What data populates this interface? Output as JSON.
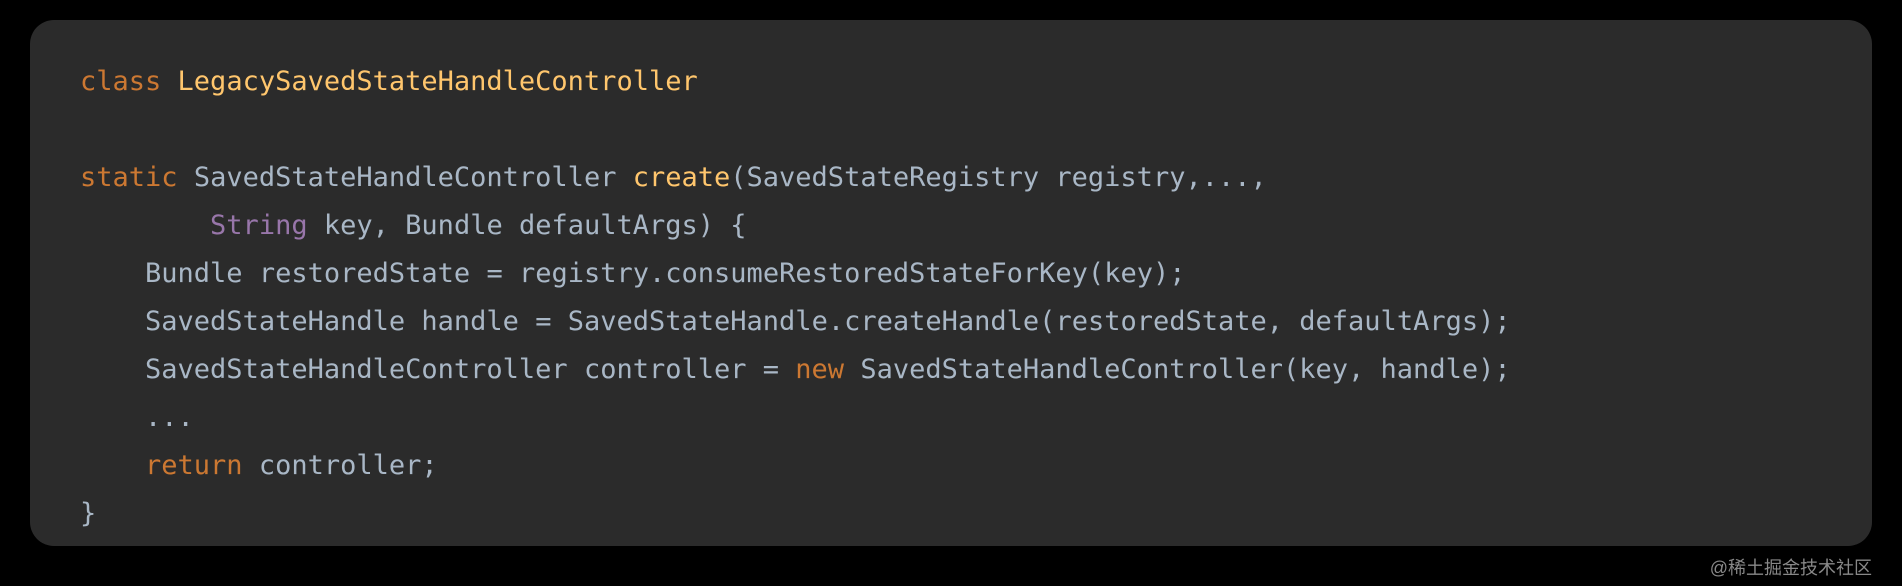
{
  "code": {
    "kw_class": "class",
    "class_name": "LegacySavedStateHandleController",
    "kw_static": "static",
    "return_type": "SavedStateHandleController",
    "method_name": "create",
    "param1_type": "SavedStateRegistry",
    "param1_name": "registry",
    "param_ellipsis": "...",
    "param2_type": "String",
    "param2_name": "key",
    "param3_type": "Bundle",
    "param3_name": "defaultArgs",
    "line3_type": "Bundle",
    "line3_var": "restoredState",
    "line3_expr_obj": "registry",
    "line3_expr_method": "consumeRestoredStateForKey",
    "line3_expr_arg": "key",
    "line4_type": "SavedStateHandle",
    "line4_var": "handle",
    "line4_expr_class": "SavedStateHandle",
    "line4_expr_method": "createHandle",
    "line4_expr_arg1": "restoredState",
    "line4_expr_arg2": "defaultArgs",
    "line5_type": "SavedStateHandleController",
    "line5_var": "controller",
    "kw_new": "new",
    "line5_ctor": "SavedStateHandleController",
    "line5_arg1": "key",
    "line5_arg2": "handle",
    "line6_dots": "...",
    "kw_return": "return",
    "return_var": "controller"
  },
  "watermark": "@稀土掘金技术社区"
}
